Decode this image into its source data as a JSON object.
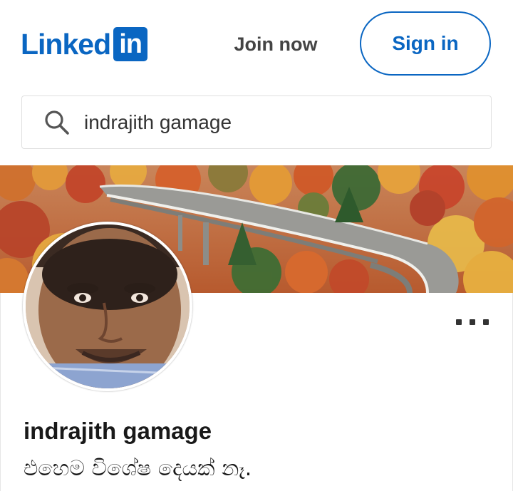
{
  "header": {
    "logo_text": "Linked",
    "logo_box_text": "in",
    "join_label": "Join now",
    "signin_label": "Sign in"
  },
  "search": {
    "value": "indrajith gamage",
    "icon": "search-icon"
  },
  "profile": {
    "name": "indrajith gamage",
    "headline": "එහෙම විශේෂ දෙයක් නෑ.",
    "more_icon": "more-options-icon"
  },
  "colors": {
    "brand": "#0a66c2",
    "text": "#191919"
  }
}
